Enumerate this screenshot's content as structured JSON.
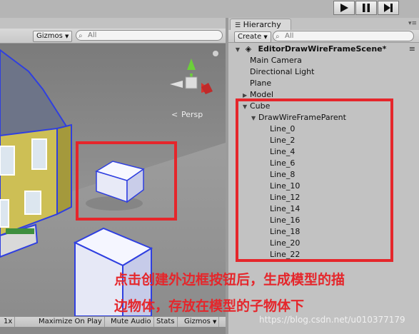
{
  "playbar": {
    "play_icon": "play-icon",
    "pause_icon": "pause-icon",
    "step_icon": "step-icon"
  },
  "scene": {
    "toolbar": {
      "gizmos_label": "Gizmos",
      "search_placeholder": "All"
    },
    "persp_label": "Persp",
    "bottom": {
      "zoom_label": "1x",
      "maximize_label": "Maximize On Play",
      "mute_label": "Mute Audio",
      "stats_label": "Stats",
      "gizmos_label": "Gizmos"
    }
  },
  "hierarchy": {
    "tab_label": "Hierarchy",
    "create_label": "Create",
    "search_placeholder": "All",
    "scene_name": "EditorDrawWireFrameScene*",
    "items": [
      {
        "label": "Main Camera",
        "level": 1,
        "arrow": ""
      },
      {
        "label": "Directional Light",
        "level": 1,
        "arrow": ""
      },
      {
        "label": "Plane",
        "level": 1,
        "arrow": ""
      },
      {
        "label": "Model",
        "level": 1,
        "arrow": "▶"
      },
      {
        "label": "Cube",
        "level": 1,
        "arrow": "▼"
      },
      {
        "label": "DrawWireFrameParent",
        "level": 2,
        "arrow": "▼"
      },
      {
        "label": "Line_0",
        "level": 3,
        "arrow": ""
      },
      {
        "label": "Line_2",
        "level": 3,
        "arrow": ""
      },
      {
        "label": "Line_4",
        "level": 3,
        "arrow": ""
      },
      {
        "label": "Line_6",
        "level": 3,
        "arrow": ""
      },
      {
        "label": "Line_8",
        "level": 3,
        "arrow": ""
      },
      {
        "label": "Line_10",
        "level": 3,
        "arrow": ""
      },
      {
        "label": "Line_12",
        "level": 3,
        "arrow": ""
      },
      {
        "label": "Line_14",
        "level": 3,
        "arrow": ""
      },
      {
        "label": "Line_16",
        "level": 3,
        "arrow": ""
      },
      {
        "label": "Line_18",
        "level": 3,
        "arrow": ""
      },
      {
        "label": "Line_20",
        "level": 3,
        "arrow": ""
      },
      {
        "label": "Line_22",
        "level": 3,
        "arrow": ""
      }
    ]
  },
  "annotation": {
    "line1": "点击创建外边框按钮后，生成模型的描",
    "line2": "边物体，存放在模型的子物体下",
    "watermark": "https://blog.csdn.net/u010377179"
  },
  "colors": {
    "annotation_red": "#e5262b",
    "wire_blue": "#2f3fe0",
    "scene_sky": "#8c8c8c"
  }
}
